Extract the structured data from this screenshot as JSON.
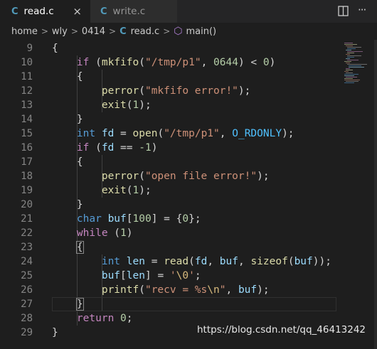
{
  "tabs": [
    {
      "icon": "C",
      "label": "read.c",
      "close": "×"
    },
    {
      "icon": "C",
      "label": "write.c"
    }
  ],
  "titlebar_icons": {
    "split": "▯",
    "more": "···"
  },
  "breadcrumb": {
    "items": [
      "home",
      "wly",
      "0414"
    ],
    "file_icon": "C",
    "file": "read.c",
    "symbol_icon": "⬡",
    "symbol": "main()",
    "separator": ">"
  },
  "code": {
    "line_numbers": [
      "9",
      "10",
      "11",
      "12",
      "13",
      "14",
      "15",
      "16",
      "17",
      "18",
      "19",
      "20",
      "21",
      "22",
      "23",
      "24",
      "25",
      "26",
      "27",
      "28",
      "29"
    ],
    "lines": [
      "{",
      "    if (mkfifo(\"/tmp/p1\", 0644) < 0)",
      "    {",
      "        perror(\"mkfifo error!\");",
      "        exit(1);",
      "    }",
      "    int fd = open(\"/tmp/p1\", O_RDONLY);",
      "    if (fd == -1)",
      "    {",
      "        perror(\"open file error!\");",
      "        exit(1);",
      "    }",
      "    char buf[100] = {0};",
      "    while (1)",
      "    {",
      "        int len = read(fd, buf, sizeof(buf));",
      "        buf[len] = '\\0';",
      "        printf(\"recv = %s\\n\", buf);",
      "    }",
      "    return 0;",
      "}"
    ]
  },
  "colors": {
    "keyword": "#c586c0",
    "type": "#569cd6",
    "function": "#dcdcaa",
    "string": "#ce9178",
    "number": "#b5cea8",
    "variable": "#9cdcfe",
    "constant": "#4fc1ff",
    "escape": "#d7ba7d"
  },
  "watermark": "https://blog.csdn.net/qq_46413242"
}
